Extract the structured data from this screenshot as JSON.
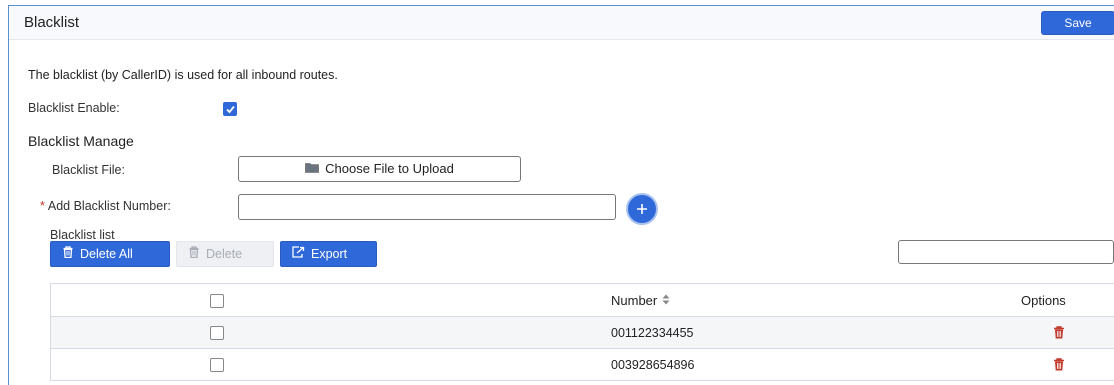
{
  "header": {
    "title": "Blacklist",
    "save_label": "Save"
  },
  "description": "The blacklist (by CallerID) is used for all inbound routes.",
  "blacklist_enable": {
    "label": "Blacklist Enable:",
    "checked": true
  },
  "manage": {
    "title": "Blacklist Manage",
    "file_label": "Blacklist File:",
    "file_button": "Choose File to Upload",
    "add_required_mark": "*",
    "add_label": "Add Blacklist Number:",
    "add_value": ""
  },
  "list": {
    "title": "Blacklist list",
    "toolbar": {
      "delete_all": "Delete All",
      "delete": "Delete",
      "export": "Export"
    },
    "search_value": "",
    "columns": {
      "number": "Number",
      "options": "Options"
    },
    "rows": [
      {
        "number": "001122334455"
      },
      {
        "number": "003928654896"
      }
    ]
  },
  "colors": {
    "accent": "#2f68d8",
    "delete_icon": "#c0392b"
  },
  "icons": {
    "add": "plus-circle-icon",
    "trash": "trash-icon",
    "export": "export-icon",
    "folder": "folder-icon",
    "sort": "sort-icon"
  }
}
